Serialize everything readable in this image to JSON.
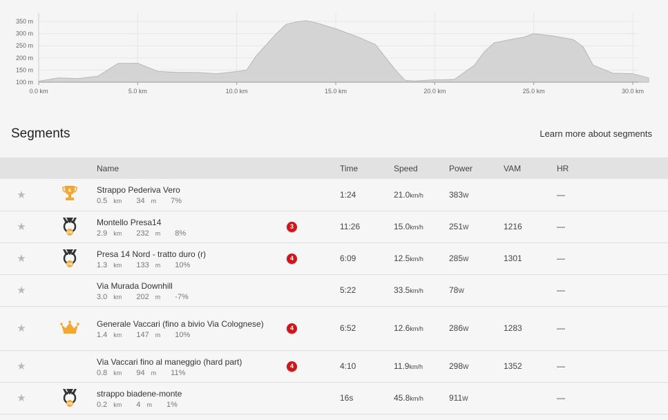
{
  "elevation": {
    "y_axis": [
      "350 m",
      "300 m",
      "250 m",
      "200 m",
      "150 m",
      "100 m"
    ],
    "x_axis": [
      "0.0 km",
      "5.0 km",
      "10.0 km",
      "15.0 km",
      "20.0 km",
      "25.0 km",
      "30.0 km"
    ],
    "profile_km": [
      0,
      1,
      2,
      3,
      4,
      5,
      6,
      7,
      8,
      9,
      10,
      10.5,
      11,
      12,
      12.5,
      13,
      13.5,
      14,
      15,
      16,
      17,
      18,
      18.5,
      19,
      20,
      20.5,
      21,
      22,
      22.5,
      23,
      24,
      24.5,
      25,
      26,
      27,
      27.5,
      28,
      29,
      30,
      30.8
    ],
    "profile_m": [
      104,
      118,
      115,
      125,
      177,
      178,
      145,
      140,
      140,
      135,
      144,
      150,
      210,
      300,
      338,
      348,
      353,
      345,
      320,
      290,
      255,
      152,
      108,
      105,
      110,
      110,
      112,
      170,
      225,
      262,
      278,
      285,
      300,
      290,
      275,
      245,
      170,
      137,
      135,
      118
    ],
    "fill_color": "#d4d4d4",
    "stroke_color": "#b8b8b8"
  },
  "segments_title": "Segments",
  "learn_more": "Learn more about segments",
  "columns": {
    "name": "Name",
    "time": "Time",
    "speed": "Speed",
    "power": "Power",
    "vam": "VAM",
    "hr": "HR"
  },
  "rows": [
    {
      "name": "Strappo Pederiva Vero",
      "dist": "0.5",
      "elev": "34",
      "grade": "7%",
      "award": "trophy",
      "award_num": "6",
      "cat": "",
      "time": "1:24",
      "speed": "21.0",
      "power": "383",
      "vam": "",
      "hr": "—"
    },
    {
      "name": "Montello Presa14",
      "dist": "2.9",
      "elev": "232",
      "grade": "8%",
      "award": "pr",
      "award_num": "PR",
      "cat": "3",
      "time": "11:26",
      "speed": "15.0",
      "power": "251",
      "vam": "1216",
      "hr": "—"
    },
    {
      "name": "Presa 14 Nord - tratto duro (r)",
      "dist": "1.3",
      "elev": "133",
      "grade": "10%",
      "award": "pr",
      "award_num": "PR",
      "cat": "4",
      "time": "6:09",
      "speed": "12.5",
      "power": "285",
      "vam": "1301",
      "hr": "—"
    },
    {
      "name": "Via Murada Downhill",
      "dist": "3.0",
      "elev": "202",
      "grade": "-7%",
      "award": "",
      "award_num": "",
      "cat": "",
      "time": "5:22",
      "speed": "33.5",
      "power": "78",
      "vam": "",
      "hr": "—"
    },
    {
      "name": "Generale Vaccari (fino a bivio Via Colognese)",
      "dist": "1.4",
      "elev": "147",
      "grade": "10%",
      "award": "crown",
      "award_num": "",
      "cat": "4",
      "time": "6:52",
      "speed": "12.6",
      "power": "286",
      "vam": "1283",
      "hr": "—"
    },
    {
      "name": "Via Vaccari fino al maneggio (hard part)",
      "dist": "0.8",
      "elev": "94",
      "grade": "11%",
      "award": "",
      "award_num": "",
      "cat": "4",
      "time": "4:10",
      "speed": "11.9",
      "power": "298",
      "vam": "1352",
      "hr": "—"
    },
    {
      "name": "strappo biadene-monte",
      "dist": "0.2",
      "elev": "4",
      "grade": "1%",
      "award": "pr",
      "award_num": "PR",
      "cat": "",
      "time": "16s",
      "speed": "45.8",
      "power": "911",
      "vam": "",
      "hr": "—"
    }
  ],
  "units": {
    "km": "km",
    "m": "m",
    "speed": "km/h",
    "power": "W"
  },
  "icons": {
    "star": "star-icon",
    "trophy": "trophy-icon",
    "pr": "pr-medal-icon",
    "crown": "crown-icon"
  },
  "colors": {
    "badge_red": "#d0151b",
    "gold": "#f0a830",
    "medal_dark": "#333333"
  }
}
